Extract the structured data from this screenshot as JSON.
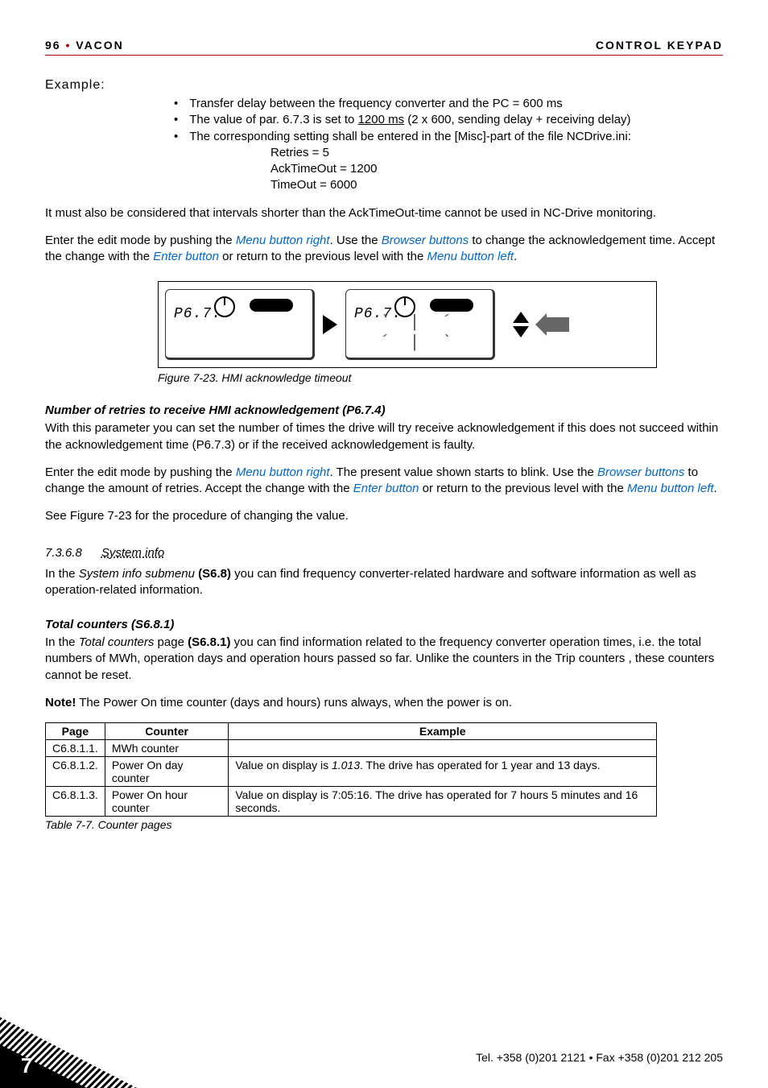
{
  "header": {
    "page_no": "96",
    "brand": "VACON",
    "right": "CONTROL KEYPAD"
  },
  "example": {
    "label": "Example:",
    "bullets": [
      "Transfer delay between the frequency converter and the PC = 600 ms",
      "The value of par. 6.7.3 is set to 1200 ms (2 x 600, sending delay +  receiving delay)",
      "The corresponding setting shall be entered in the [Misc]-part of the file NCDrive.ini:"
    ],
    "subs": [
      "Retries = 5",
      "AckTimeOut = 1200",
      "TimeOut = 6000"
    ]
  },
  "para1": "It must also be considered that intervals shorter than the AckTimeOut-time cannot be used in  NC-Drive monitoring.",
  "para2a": "Enter the edit mode by pushing the ",
  "para2b": ". Use the ",
  "para2c": " to change the acknowledgement time. Accept the change with the ",
  "para2d": " or return to the previous level with the ",
  "para2e": ".",
  "links": {
    "menu_right": "Menu button right",
    "browser": "Browser buttons",
    "enter": "Enter button",
    "menu_left": "Menu button left"
  },
  "panel_code": "P6.7.3",
  "fig_caption": "Figure 7-23. HMI acknowledge timeout",
  "h_retries": "Number of retries to receive HMI acknowledgement (P6.7.4)",
  "retries_p1": "With this parameter you can set the number of times the drive will try receive acknowledgement if this does not succeed within the acknowledgement time (P6.7.3) or if the received acknowledgement is faulty.",
  "retries_p2a": "Enter the edit mode by pushing the ",
  "retries_p2b": ". The present value shown starts to blink. Use the ",
  "retries_p2c": " to change the amount of retries. Accept the change with the ",
  "retries_p2d": " or return to the previous level with the ",
  "retries_p2e": ".",
  "retries_p3": "See Figure 7-23 for the procedure of changing the value.",
  "sec_num": "7.3.6.8",
  "sec_name": "System info",
  "sysinfo_p_a": "In the ",
  "sysinfo_sub": "System info submenu",
  "sysinfo_bold": " (S6.8)",
  "sysinfo_p_b": " you can find frequency converter-related hardware and software information as well as operation-related information.",
  "h_total": "Total counters (S6.8.1)",
  "total_p_a": "In the ",
  "total_it": "Total counters",
  "total_p_b": " page ",
  "total_bold": "(S6.8.1)",
  "total_p_c": " you can find information related to the frequency converter operation times, i.e. the total numbers of MWh, operation days and operation hours passed so far. Unlike the counters in the Trip counters , these counters cannot be reset.",
  "note_bold": "Note!",
  "note_rest": " The Power On time counter (days and hours) runs always, when the power is on.",
  "table": {
    "headers": [
      "Page",
      "Counter",
      "Example"
    ],
    "rows": [
      {
        "page": "C6.8.1.1.",
        "counter": "MWh counter",
        "example": ""
      },
      {
        "page": "C6.8.1.2.",
        "counter": "Power On day counter",
        "example_pre": "Value on display is ",
        "example_it": "1.013",
        "example_post": ". The drive has operated for 1 year and 13 days."
      },
      {
        "page": "C6.8.1.3.",
        "counter": "Power On hour counter",
        "example": "Value on display is 7:05:16. The drive has operated for 7 hours 5 minutes and 16 seconds."
      }
    ]
  },
  "table_caption": "Table 7-7. Counter pages",
  "footer": {
    "num": "7",
    "contact": "Tel. +358 (0)201 2121 • Fax +358 (0)201 212 205"
  }
}
